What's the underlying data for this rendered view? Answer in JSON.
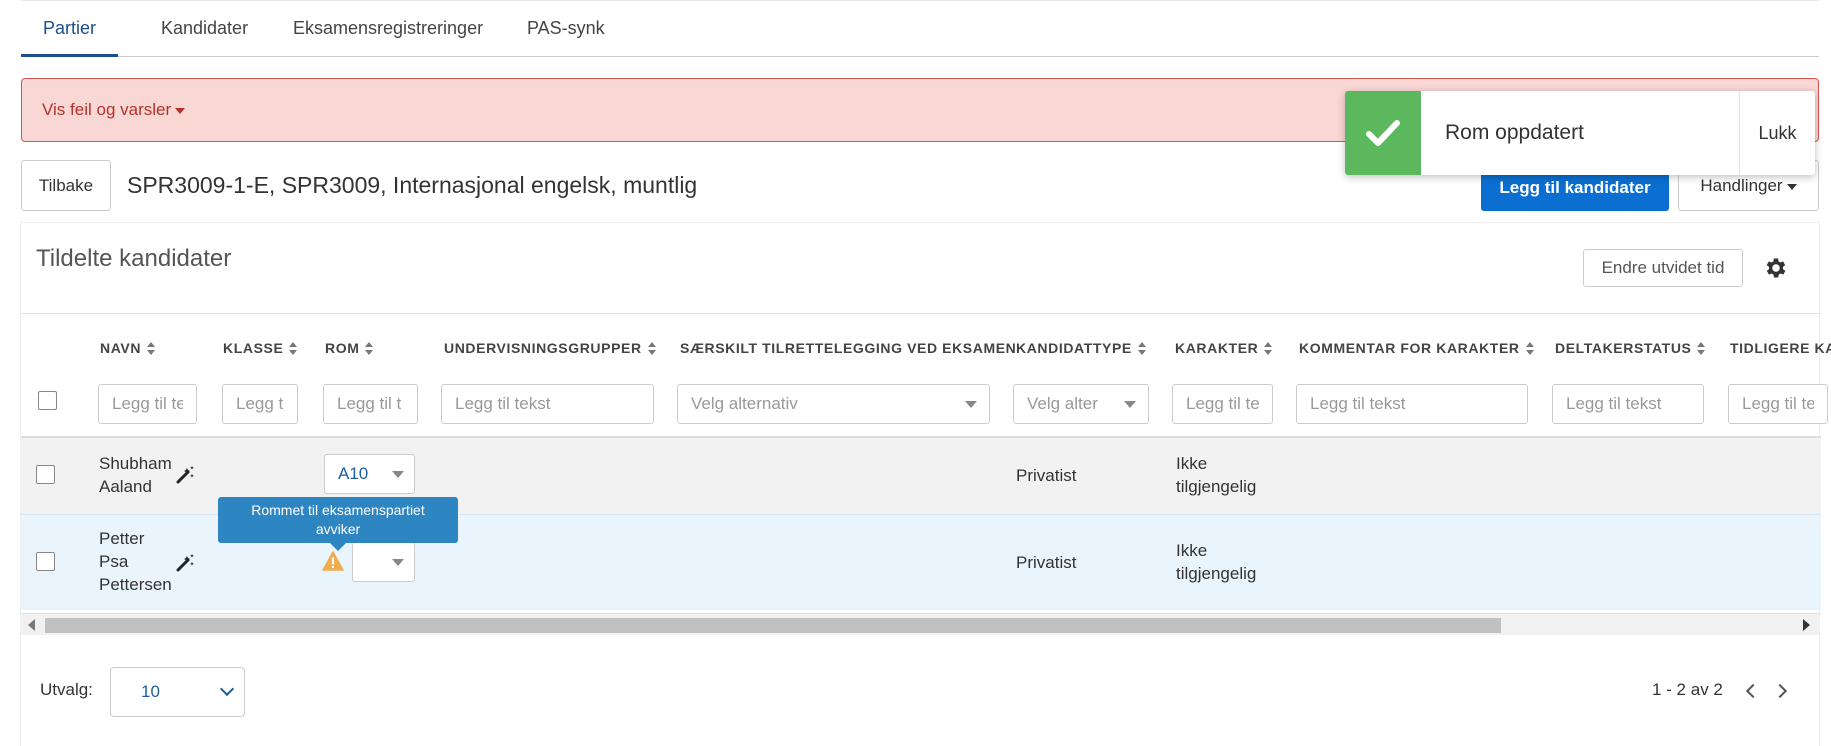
{
  "tabs": [
    {
      "label": "Partier"
    },
    {
      "label": "Kandidater"
    },
    {
      "label": "Eksamensregistreringer"
    },
    {
      "label": "PAS-synk"
    }
  ],
  "alert": {
    "label": "Vis feil og varsler",
    "color": "#b5312a"
  },
  "toast": {
    "message": "Rom oppdatert",
    "close_label": "Lukk",
    "icon": "check-icon",
    "accent": "#5cb85c"
  },
  "header": {
    "back_label": "Tilbake",
    "title": "SPR3009-1-E, SPR3009, Internasjonal engelsk, muntlig",
    "add_label": "Legg til kandidater",
    "actions_label": "Handlinger"
  },
  "panel": {
    "title": "Tildelte kandidater",
    "extend_label": "Endre utvidet tid"
  },
  "columns": {
    "navn": "NAVN",
    "klasse": "KLASSE",
    "rom": "ROM",
    "grupper": "UNDERVISNINGSGRUPPER",
    "tilrettelegging": "SÆRSKILT TILRETTELEGGING VED EKSAMEN",
    "kandidattype": "KANDIDATTYPE",
    "karakter": "KARAKTER",
    "kommentar": "KOMMENTAR FOR KARAKTER",
    "deltakerstatus": "DELTAKERSTATUS",
    "tidligere": "TIDLIGERE KA"
  },
  "filters": {
    "text_placeholder": "Legg til tekst",
    "select_placeholder": "Velg alternativ",
    "navn": "Legg til te",
    "klasse": "Legg t",
    "rom": "Legg til t",
    "kandidattype": "Velg alter",
    "karakter": "Legg til te",
    "tidligere": "Legg til te"
  },
  "rows": [
    {
      "name_line1": "Shubham",
      "name_line2": "Aaland",
      "name_line3": "",
      "room": "A10",
      "kandidattype": "Privatist",
      "karakter_line1": "Ikke",
      "karakter_line2": "tilgjengelig"
    },
    {
      "name_line1": "Petter",
      "name_line2": "Psa",
      "name_line3": "Pettersen",
      "room": "",
      "kandidattype": "Privatist",
      "karakter_line1": "Ikke",
      "karakter_line2": "tilgjengelig"
    }
  ],
  "tooltip": {
    "line1": "Rommet til eksamenspartiet",
    "line2": "avviker"
  },
  "footer": {
    "utvalg_label": "Utvalg:",
    "page_size": "10",
    "page_info": "1 - 2 av 2"
  }
}
